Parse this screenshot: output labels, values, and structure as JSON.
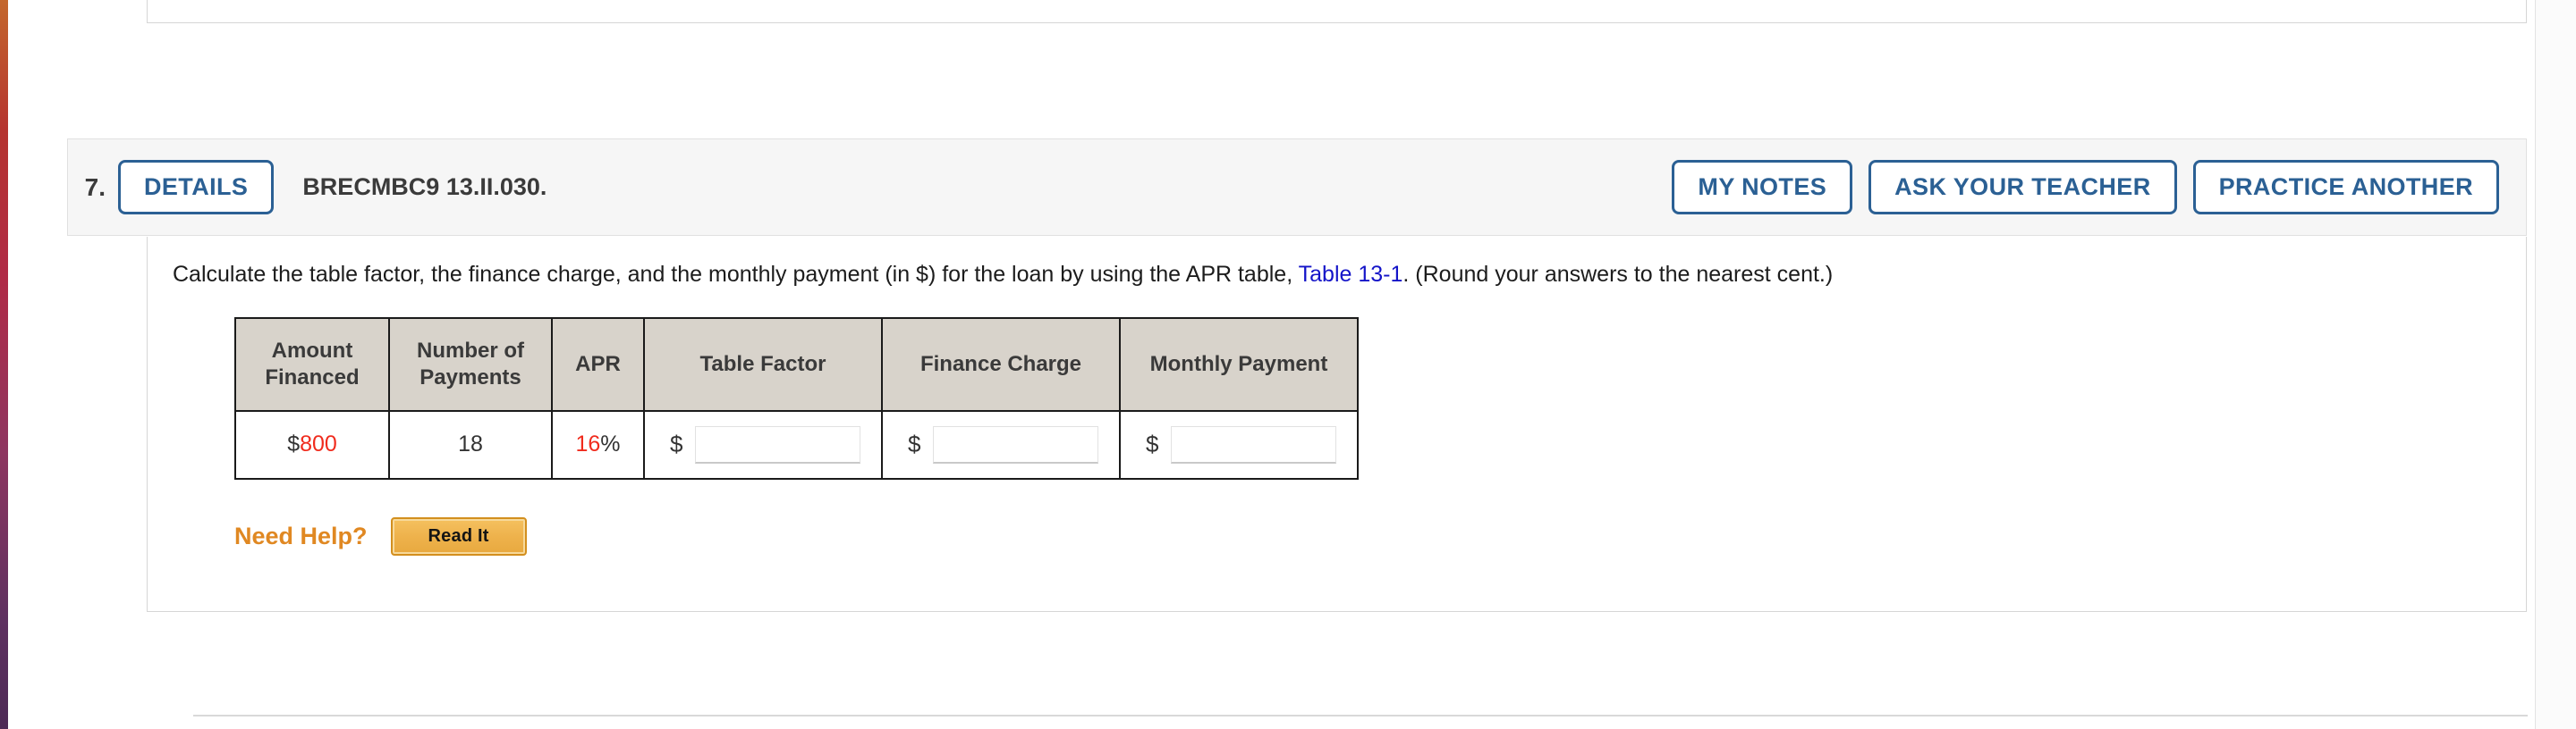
{
  "question": {
    "number": "7.",
    "details_label": "DETAILS",
    "code": "BRECMBC9 13.II.030.",
    "actions": [
      {
        "name": "my-notes",
        "label": "MY NOTES"
      },
      {
        "name": "ask-your-teacher",
        "label": "ASK YOUR TEACHER"
      },
      {
        "name": "practice-another",
        "label": "PRACTICE ANOTHER"
      }
    ],
    "prompt": {
      "before_link": "Calculate the table factor, the finance charge, and the monthly payment (in $) for the loan by using the APR table, ",
      "link_text": "Table 13-1",
      "after_link": ". (Round your answers to the nearest cent.)"
    },
    "table": {
      "headers": [
        "Amount\nFinanced",
        "Number of\nPayments",
        "APR",
        "Table\nFactor",
        "Finance\nCharge",
        "Monthly\nPayment"
      ],
      "headers_flat": [
        "Amount Financed",
        "Number of Payments",
        "APR",
        "Table Factor",
        "Finance Charge",
        "Monthly Payment"
      ],
      "row": {
        "amount_financed_prefix": "$",
        "amount_financed_value": "800",
        "number_of_payments": "18",
        "apr_value": "16",
        "apr_suffix": "%",
        "table_factor_prefix": "$",
        "table_factor_value": "",
        "finance_charge_prefix": "$",
        "finance_charge_value": "",
        "monthly_payment_prefix": "$",
        "monthly_payment_value": ""
      }
    },
    "need_help": {
      "label": "Need Help?",
      "read_it_label": "Read It"
    }
  },
  "colors": {
    "button_blue": "#2b6094",
    "link_blue": "#1414c8",
    "value_red": "#f02b1d",
    "header_bg": "#d8d3cb",
    "need_help_orange": "#e08822",
    "read_it_gold": "#eeb24c"
  }
}
